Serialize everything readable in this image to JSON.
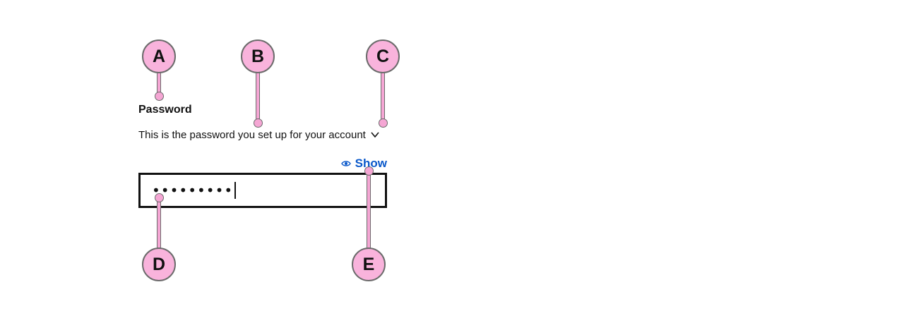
{
  "form": {
    "label": "Password",
    "hint": "This is the password you set up for your account",
    "show_label": "Show",
    "password_masked": "•••••••••",
    "accent_color": "#0a58ca"
  },
  "icons": {
    "chevron": "chevron-down-icon",
    "eye": "eye-icon"
  },
  "annotations": {
    "a": "A",
    "b": "B",
    "c": "C",
    "d": "D",
    "e": "E",
    "color": "#f9b3dc"
  }
}
